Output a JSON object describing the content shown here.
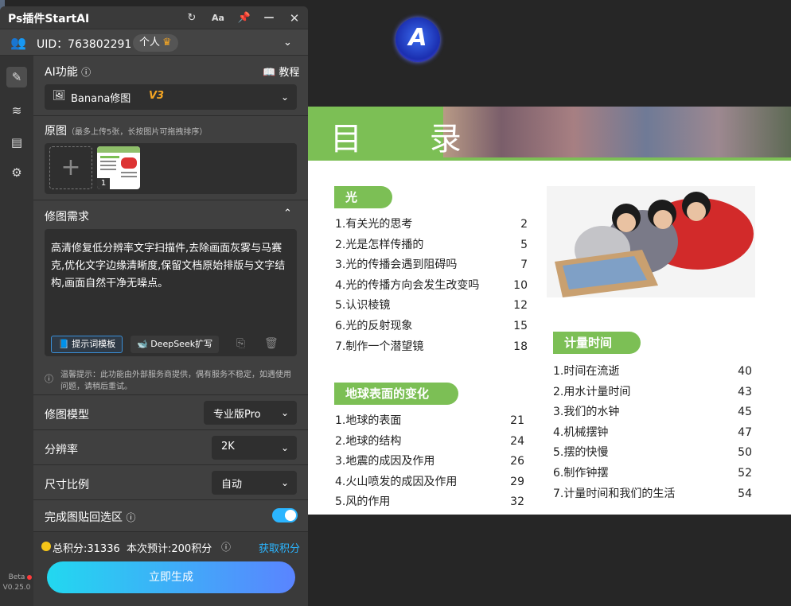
{
  "window": {
    "title": "Ps插件StartAI"
  },
  "user": {
    "uid_label": "UID：763802291",
    "badge": "个人"
  },
  "ai_function": {
    "label": "AI功能",
    "tutorial": "教程",
    "selected_model": "Banana修图",
    "version_tag": "V3"
  },
  "source_image": {
    "label": "原图",
    "hint": "（最多上传5张，长按图片可拖拽排序）",
    "thumb_index": "1"
  },
  "request": {
    "label": "修图需求",
    "text": "高清修复低分辨率文字扫描件,去除画面灰雾与马赛克,优化文字边缘清晰度,保留文档原始排版与文字结构,画面自然干净无噪点。",
    "template_button": "提示词模板",
    "deepseek_button": "DeepSeek扩写"
  },
  "notice": "温馨提示：此功能由外部服务商提供，偶有服务不稳定，如遇使用问题，请稍后重试。",
  "settings": {
    "model_label": "修图模型",
    "model_value": "专业版Pro",
    "resolution_label": "分辨率",
    "resolution_value": "2K",
    "ratio_label": "尺寸比例",
    "ratio_value": "自动",
    "paste_back_label": "完成图贴回选区"
  },
  "points": {
    "text": "总积分:31336  本次预计:200积分",
    "get_link": "获取积分"
  },
  "generate_button": "立即生成",
  "sidebar": {
    "beta": "Beta",
    "version": "V0.25.0"
  },
  "document": {
    "title": "目 录",
    "sections": [
      {
        "heading": "光",
        "items": [
          {
            "t": "1.有关光的思考",
            "p": "2"
          },
          {
            "t": "2.光是怎样传播的",
            "p": "5"
          },
          {
            "t": "3.光的传播会遇到阻碍吗",
            "p": "7"
          },
          {
            "t": "4.光的传播方向会发生改变吗",
            "p": "10"
          },
          {
            "t": "5.认识棱镜",
            "p": "12"
          },
          {
            "t": "6.光的反射现象",
            "p": "15"
          },
          {
            "t": "7.制作一个潜望镜",
            "p": "18"
          }
        ]
      },
      {
        "heading": "地球表面的变化",
        "items": [
          {
            "t": "1.地球的表面",
            "p": "21"
          },
          {
            "t": "2.地球的结构",
            "p": "24"
          },
          {
            "t": "3.地震的成因及作用",
            "p": "26"
          },
          {
            "t": "4.火山喷发的成因及作用",
            "p": "29"
          },
          {
            "t": "5.风的作用",
            "p": "32"
          }
        ]
      },
      {
        "heading": "计量时间",
        "items": [
          {
            "t": "1.时间在流逝",
            "p": "40"
          },
          {
            "t": "2.用水计量时间",
            "p": "43"
          },
          {
            "t": "3.我们的水钟",
            "p": "45"
          },
          {
            "t": "4.机械摆钟",
            "p": "47"
          },
          {
            "t": "5.摆的快慢",
            "p": "50"
          },
          {
            "t": "6.制作钟摆",
            "p": "52"
          },
          {
            "t": "7.计量时间和我们的生活",
            "p": "54"
          }
        ]
      }
    ]
  },
  "colors": {
    "accent": "#2bb5ff",
    "doc_green": "#7cbf55",
    "gold": "#f5a623",
    "version_orange": "#f5a623"
  }
}
